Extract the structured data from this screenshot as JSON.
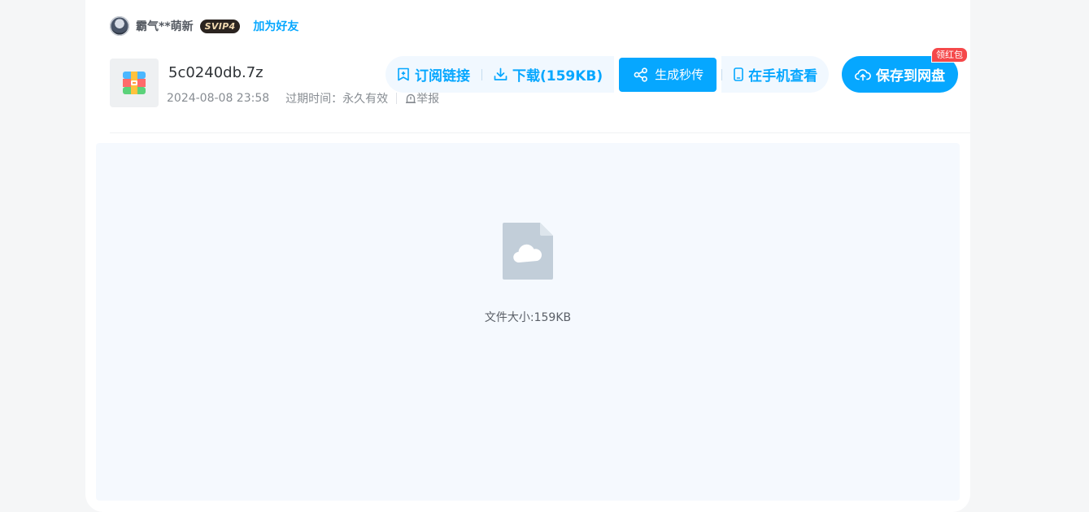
{
  "user": {
    "name": "霸气**萌新",
    "vip_label": "SVIP4",
    "add_friend_label": "加为好友"
  },
  "file": {
    "name": "5c0240db.7z",
    "date": "2024-08-08 23:58",
    "expire": "过期时间：永久有效",
    "report_label": "举报",
    "icon": "archive-file-icon"
  },
  "toolbar": {
    "subscribe_label": "订阅链接",
    "download_label": "下载(159KB)",
    "quick_share_label": "生成秒传",
    "phone_view_label": "在手机查看",
    "save_label": "保存到网盘",
    "save_badge": "领红包"
  },
  "preview": {
    "icon": "cloud-file-icon",
    "size_text": "文件大小:159KB"
  },
  "colors": {
    "accent": "#06a7ff",
    "badge_red": "#f5484a",
    "preview_bg": "#f5f9fe"
  }
}
